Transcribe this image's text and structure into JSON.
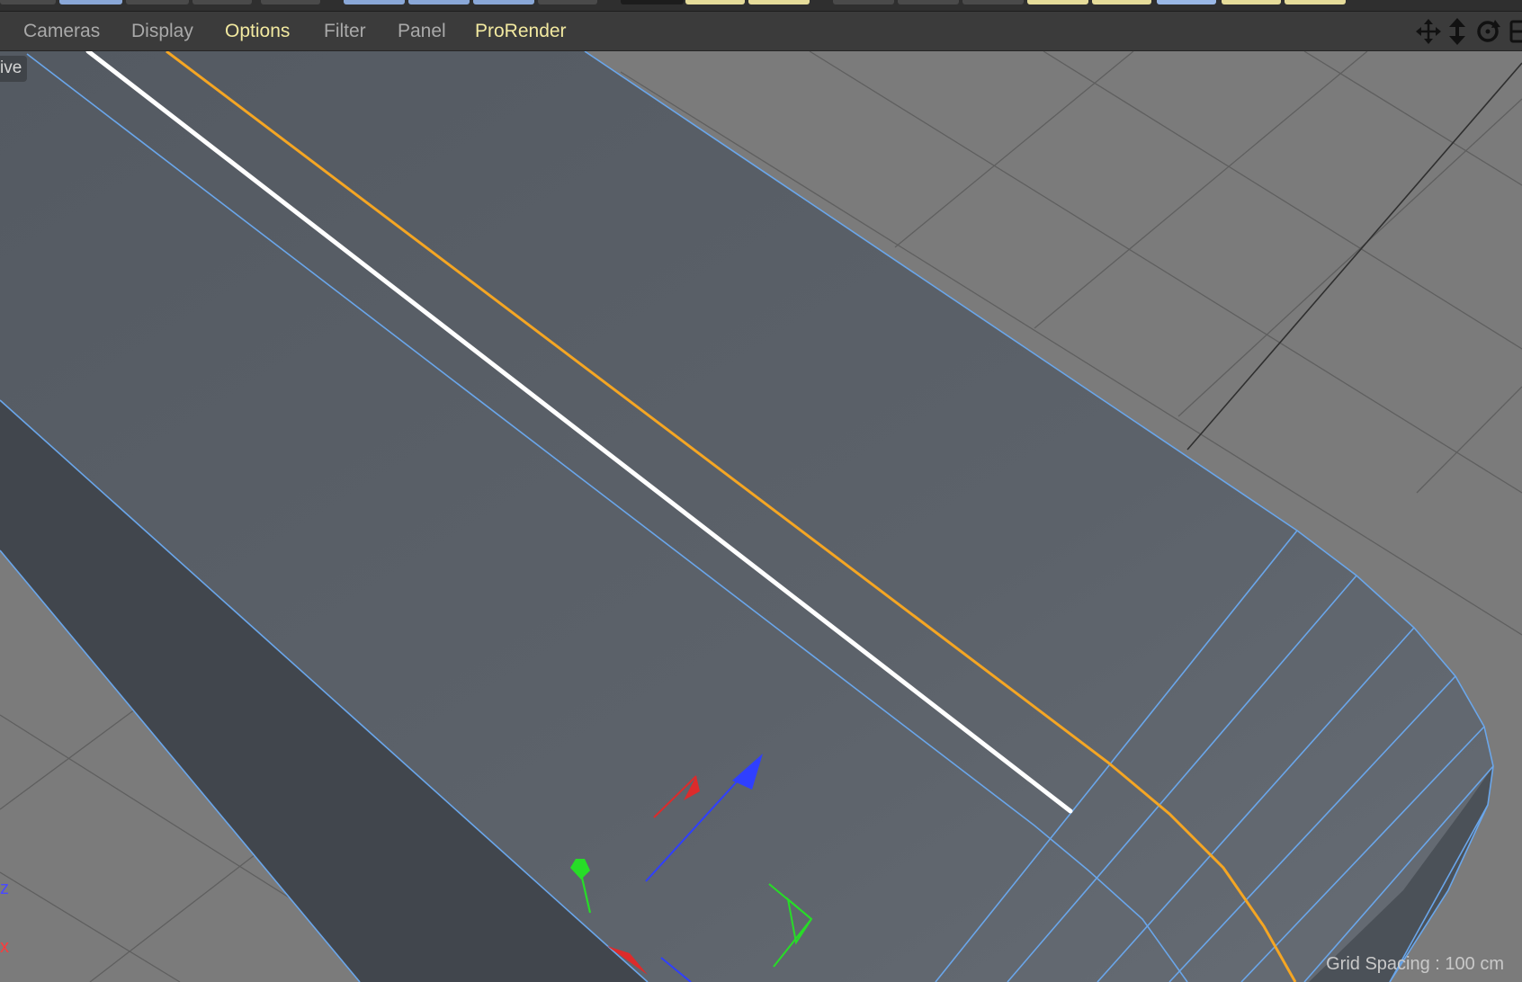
{
  "menu": {
    "items": [
      {
        "label": "Cameras"
      },
      {
        "label": "Display"
      },
      {
        "label": "Options"
      },
      {
        "label": "Filter"
      },
      {
        "label": "Panel"
      },
      {
        "label": "ProRender"
      }
    ]
  },
  "nav_icons": {
    "move": "move-cross-icon",
    "zoom": "zoom-arrows-icon",
    "rotate": "rotate-icon",
    "toggle": "panel-toggle-icon"
  },
  "viewport": {
    "camera_label": "ive",
    "axis_z": "z",
    "axis_x": "x",
    "grid_spacing": "Grid Spacing : 100 cm"
  },
  "colors": {
    "menu_text": "#a9a9a9",
    "menu_highlight": "#f2e9a0",
    "mesh_face": "#5a6068",
    "mesh_edge": "#6aa6ea",
    "selected_edge": "#f5a623",
    "active_edge": "#ffffff",
    "floor": "#7d7d7d"
  }
}
